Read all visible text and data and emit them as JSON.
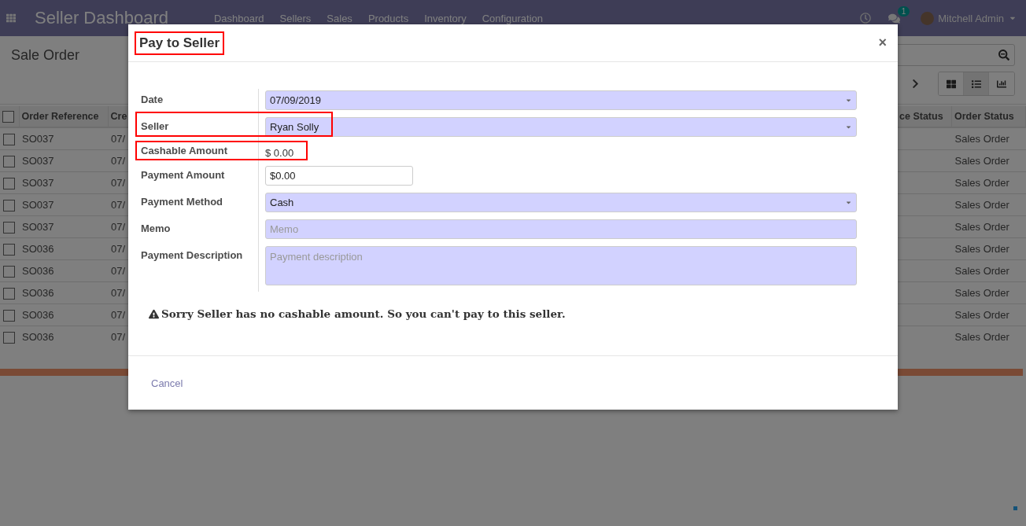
{
  "navbar": {
    "app_title": "Seller Dashboard",
    "menu": [
      "Dashboard",
      "Sellers",
      "Sales",
      "Products",
      "Inventory",
      "Configuration"
    ],
    "message_count": "1",
    "user": "Mitchell Admin"
  },
  "control_panel": {
    "breadcrumb": "Sale Order",
    "views": [
      {
        "kind": "kanban",
        "selected": false
      },
      {
        "kind": "list",
        "selected": true
      },
      {
        "kind": "graph",
        "selected": false
      }
    ]
  },
  "table": {
    "all_checked": false,
    "columns": [
      "Order Reference",
      "Cre",
      "ce Status",
      "Order Status"
    ],
    "rows": [
      {
        "checked": false,
        "cells": [
          "SO037",
          "07/",
          "",
          "Sales Order"
        ]
      },
      {
        "checked": false,
        "cells": [
          "SO037",
          "07/",
          "",
          "Sales Order"
        ]
      },
      {
        "checked": false,
        "cells": [
          "SO037",
          "07/",
          "",
          "Sales Order"
        ]
      },
      {
        "checked": false,
        "cells": [
          "SO037",
          "07/",
          "",
          "Sales Order"
        ]
      },
      {
        "checked": false,
        "cells": [
          "SO037",
          "07/",
          "",
          "Sales Order"
        ]
      },
      {
        "checked": false,
        "cells": [
          "SO036",
          "07/",
          "",
          "Sales Order"
        ]
      },
      {
        "checked": false,
        "cells": [
          "SO036",
          "07/",
          "",
          "Sales Order"
        ]
      },
      {
        "checked": false,
        "cells": [
          "SO036",
          "07/",
          "",
          "Sales Order"
        ]
      },
      {
        "checked": false,
        "cells": [
          "SO036",
          "07/",
          "",
          "Sales Order"
        ]
      },
      {
        "checked": false,
        "cells": [
          "SO036",
          "07/",
          "",
          "Sales Order"
        ]
      }
    ]
  },
  "dialog": {
    "title": "Pay to Seller",
    "title_highlighted": true,
    "close": "×",
    "fields": [
      {
        "label": "Date",
        "kind": "select",
        "value": "07/09/2019",
        "highlighted": false
      },
      {
        "label": "Seller",
        "kind": "select",
        "value": "Ryan Solly",
        "highlighted": true
      },
      {
        "label": "Cashable Amount",
        "kind": "text",
        "value": "$ 0.00",
        "highlighted": true
      },
      {
        "label": "Payment Amount",
        "kind": "amount",
        "value": "$0.00",
        "highlighted": false
      },
      {
        "label": "Payment Method",
        "kind": "select",
        "value": "Cash",
        "highlighted": false
      },
      {
        "label": "Memo",
        "kind": "input",
        "placeholder": "Memo",
        "highlighted": false
      },
      {
        "label": "Payment Description",
        "kind": "textarea",
        "placeholder": "Payment description",
        "highlighted": false
      }
    ],
    "warning": "Sorry Seller has no cashable amount. So you can't pay to this seller.",
    "cancel": "Cancel"
  }
}
